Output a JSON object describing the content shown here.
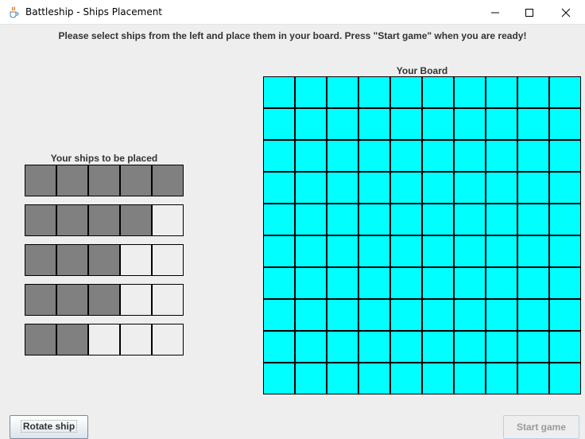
{
  "window": {
    "title": "Battleship - Ships Placement",
    "app_icon": "java-cup-icon",
    "controls": [
      "minimize-icon",
      "maximize-icon",
      "close-icon"
    ]
  },
  "instruction": "Please select ships from the left and place them in your board. Press \"Start game\" when you are ready!",
  "ships_panel": {
    "title": "Your ships to be placed",
    "ships": [
      {
        "length": 5
      },
      {
        "length": 4
      },
      {
        "length": 3
      },
      {
        "length": 3
      },
      {
        "length": 2
      }
    ],
    "slots_per_row": 5,
    "ship_color": "#808080",
    "empty_color": "#eeeeee"
  },
  "board": {
    "title": "Your Board",
    "rows": 10,
    "cols": 10,
    "water_color": "#00ffff"
  },
  "buttons": {
    "rotate_label": "Rotate ship",
    "start_label": "Start game",
    "start_enabled": false
  }
}
